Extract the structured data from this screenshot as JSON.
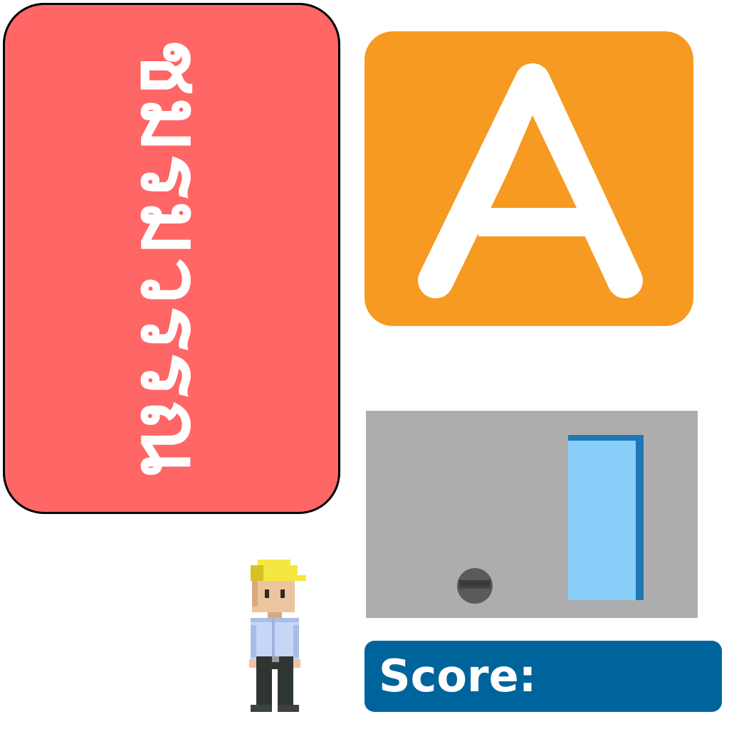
{
  "word_card": {
    "text": "ชมรมวรรณ",
    "background": "#ff6666",
    "text_color": "#ffffff"
  },
  "letter_tile": {
    "letter": "A",
    "background": "#f69a22",
    "letter_color": "#ffffff"
  },
  "scene": {
    "panel_color": "#adadad",
    "door_color": "#87cefa",
    "door_frame_color": "#1f77b4",
    "icons": [
      "door-icon",
      "knob-icon"
    ]
  },
  "player": {
    "sprite": "construction-worker-icon",
    "helmet_color": "#f5e642",
    "shirt_color": "#c6d6f7",
    "pants_color": "#2f3532"
  },
  "score": {
    "label": "Score:",
    "value": "",
    "background": "#00649c"
  }
}
